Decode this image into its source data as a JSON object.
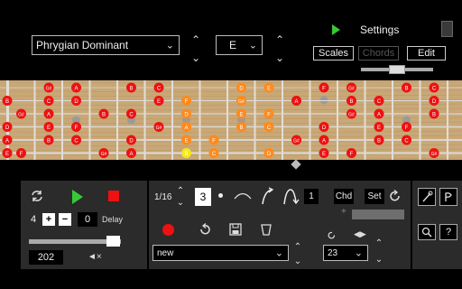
{
  "header": {
    "scale_select": "Phrygian Dominant",
    "key_select": "E",
    "settings_label": "Settings",
    "tabs": {
      "scales": "Scales",
      "chords": "Chords",
      "edit": "Edit"
    },
    "colors": {
      "accent": "#37c837"
    }
  },
  "fretboard": {
    "strings": 6,
    "frets": 16,
    "inlay_frets": [
      3,
      5,
      7,
      9,
      12,
      15
    ],
    "colors": {
      "wood": "#c9a877",
      "note": "#ee1111",
      "note_text": "#ffffff",
      "orange": "#ff8a1c",
      "root_yellow": "#f4e91a"
    },
    "notes": [
      {
        "s": 0,
        "f": 2,
        "t": "G#"
      },
      {
        "s": 0,
        "f": 3,
        "t": "A"
      },
      {
        "s": 0,
        "f": 5,
        "t": "B"
      },
      {
        "s": 0,
        "f": 6,
        "t": "C"
      },
      {
        "s": 0,
        "f": 9,
        "t": "D"
      },
      {
        "s": 0,
        "f": 10,
        "t": "E"
      },
      {
        "s": 0,
        "f": 12,
        "t": "F"
      },
      {
        "s": 0,
        "f": 13,
        "t": "G#"
      },
      {
        "s": 0,
        "f": 15,
        "t": "B"
      },
      {
        "s": 0,
        "f": 16,
        "t": "C"
      },
      {
        "s": 1,
        "f": 0,
        "t": "B"
      },
      {
        "s": 1,
        "f": 2,
        "t": "C"
      },
      {
        "s": 1,
        "f": 3,
        "t": "D"
      },
      {
        "s": 1,
        "f": 6,
        "t": "E"
      },
      {
        "s": 1,
        "f": 7,
        "t": "F"
      },
      {
        "s": 1,
        "f": 9,
        "t": "G#"
      },
      {
        "s": 1,
        "f": 11,
        "t": "A"
      },
      {
        "s": 1,
        "f": 13,
        "t": "B"
      },
      {
        "s": 1,
        "f": 14,
        "t": "C"
      },
      {
        "s": 1,
        "f": 16,
        "t": "D"
      },
      {
        "s": 2,
        "f": 1,
        "t": "G#"
      },
      {
        "s": 2,
        "f": 2,
        "t": "A"
      },
      {
        "s": 2,
        "f": 4,
        "t": "B"
      },
      {
        "s": 2,
        "f": 5,
        "t": "C"
      },
      {
        "s": 2,
        "f": 7,
        "t": "D"
      },
      {
        "s": 2,
        "f": 9,
        "t": "E"
      },
      {
        "s": 2,
        "f": 10,
        "t": "F"
      },
      {
        "s": 2,
        "f": 13,
        "t": "G#"
      },
      {
        "s": 2,
        "f": 14,
        "t": "A"
      },
      {
        "s": 2,
        "f": 16,
        "t": "B"
      },
      {
        "s": 3,
        "f": 0,
        "t": "D"
      },
      {
        "s": 3,
        "f": 2,
        "t": "E"
      },
      {
        "s": 3,
        "f": 3,
        "t": "F"
      },
      {
        "s": 3,
        "f": 6,
        "t": "G#"
      },
      {
        "s": 3,
        "f": 7,
        "t": "A"
      },
      {
        "s": 3,
        "f": 9,
        "t": "B"
      },
      {
        "s": 3,
        "f": 10,
        "t": "C"
      },
      {
        "s": 3,
        "f": 12,
        "t": "D"
      },
      {
        "s": 3,
        "f": 14,
        "t": "E"
      },
      {
        "s": 3,
        "f": 15,
        "t": "F"
      },
      {
        "s": 4,
        "f": 0,
        "t": "A"
      },
      {
        "s": 4,
        "f": 2,
        "t": "B"
      },
      {
        "s": 4,
        "f": 3,
        "t": "C"
      },
      {
        "s": 4,
        "f": 5,
        "t": "D"
      },
      {
        "s": 4,
        "f": 7,
        "t": "E"
      },
      {
        "s": 4,
        "f": 8,
        "t": "F"
      },
      {
        "s": 4,
        "f": 11,
        "t": "G#"
      },
      {
        "s": 4,
        "f": 12,
        "t": "A"
      },
      {
        "s": 4,
        "f": 14,
        "t": "B"
      },
      {
        "s": 4,
        "f": 15,
        "t": "C"
      },
      {
        "s": 5,
        "f": 0,
        "t": "E"
      },
      {
        "s": 5,
        "f": 1,
        "t": "F"
      },
      {
        "s": 5,
        "f": 4,
        "t": "G#"
      },
      {
        "s": 5,
        "f": 5,
        "t": "A"
      },
      {
        "s": 5,
        "f": 7,
        "t": "B"
      },
      {
        "s": 5,
        "f": 8,
        "t": "C"
      },
      {
        "s": 5,
        "f": 10,
        "t": "D"
      },
      {
        "s": 5,
        "f": 12,
        "t": "E"
      },
      {
        "s": 5,
        "f": 13,
        "t": "F"
      },
      {
        "s": 5,
        "f": 16,
        "t": "G#"
      }
    ],
    "highlight_frets": [
      7,
      8,
      9,
      10
    ],
    "yellow_note": {
      "s": 5,
      "f": 7
    }
  },
  "player": {
    "loop_count": "4",
    "plus": "+",
    "minus": "−",
    "delay_value": "0",
    "delay_label": "Delay",
    "tempo": "202",
    "volume_level": 0.93
  },
  "editor": {
    "note_length": "1/16",
    "tuplet": "3",
    "count": "1",
    "chd_label": "Chd",
    "set_label": "Set",
    "preset_select": "new",
    "bar_select": "23"
  }
}
